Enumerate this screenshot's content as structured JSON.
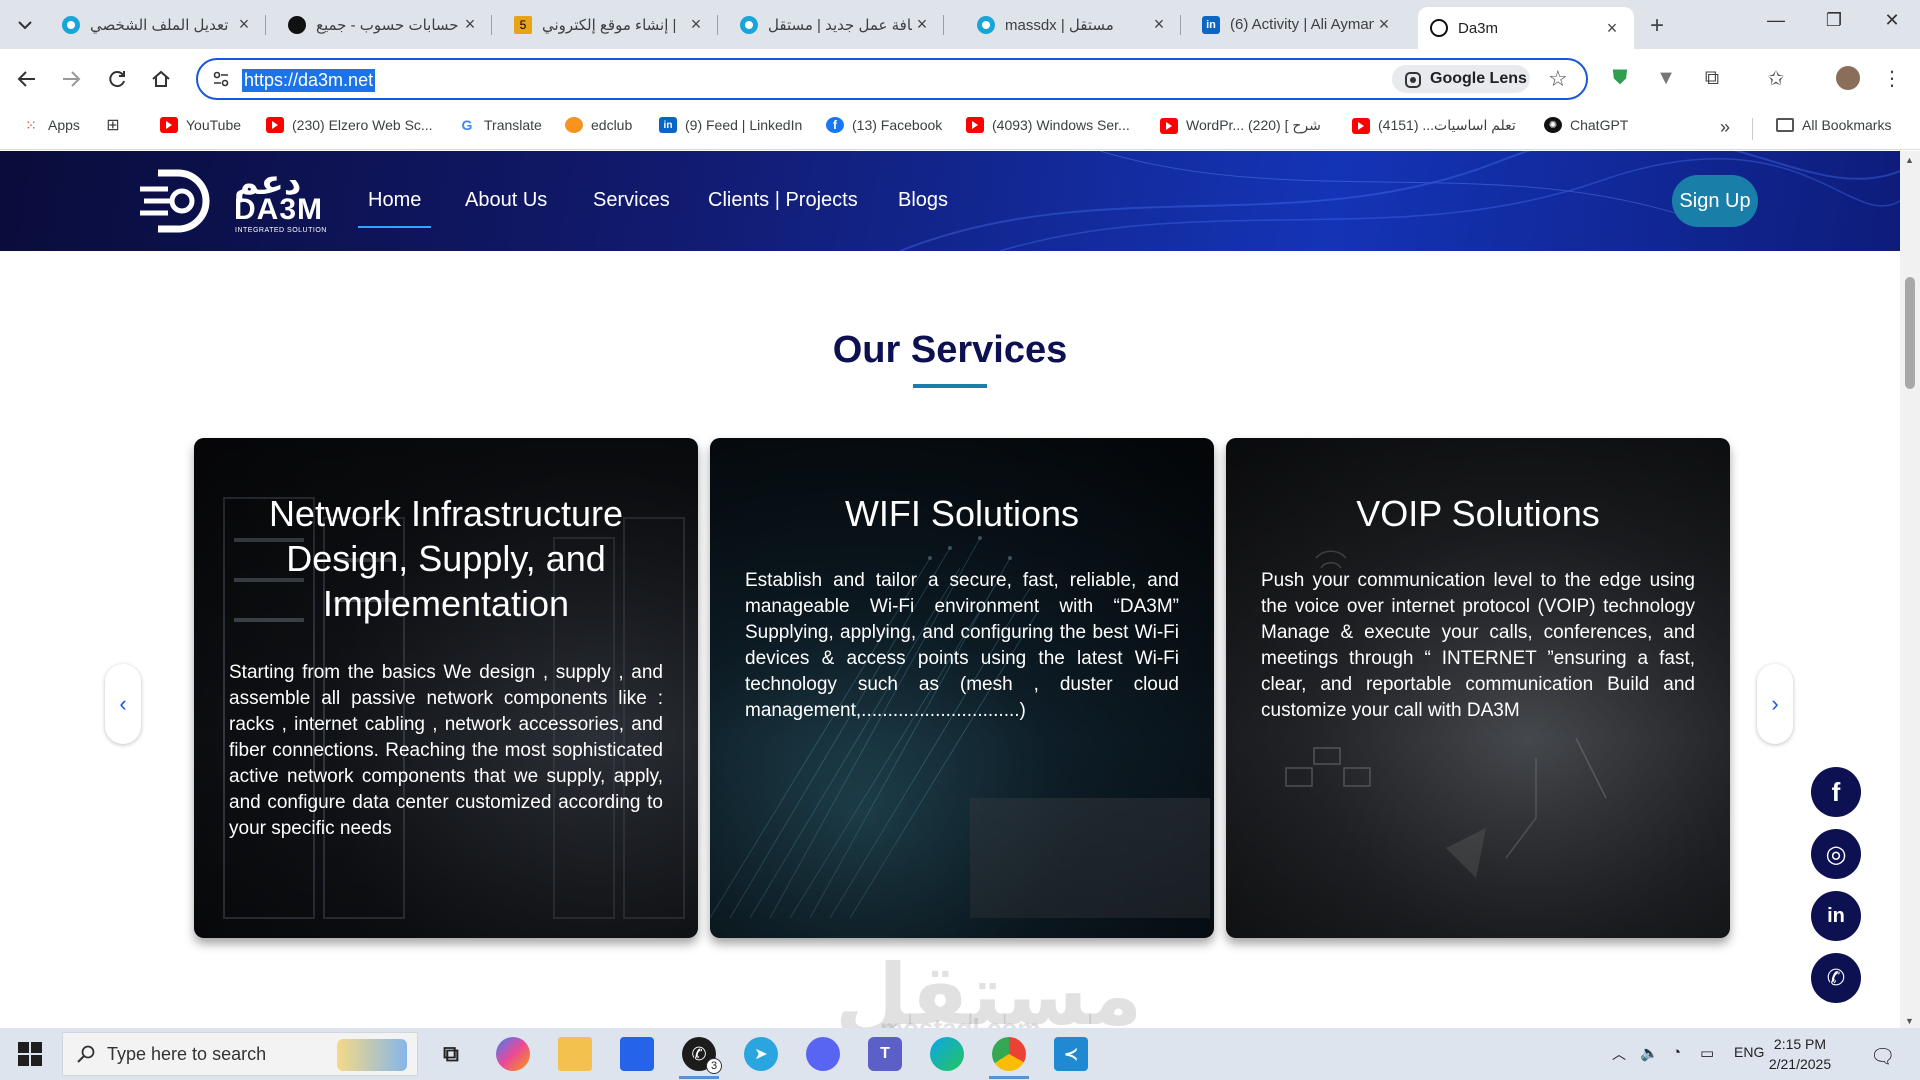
{
  "browser": {
    "tabs": [
      {
        "title": "تعديل الملف الشخصي",
        "icon": "mostaql-icon",
        "active": false
      },
      {
        "title": "حسابات حسوب - جميع",
        "icon": "hsoub-icon",
        "active": false
      },
      {
        "title": "إنشاء موقع إلكتروني |",
        "icon": "five-icon",
        "active": false
      },
      {
        "title": "إضافة عمل جديد | مستقل",
        "icon": "mostaql-icon",
        "active": false
      },
      {
        "title": "massdx | مستقل",
        "icon": "mostaql-icon",
        "active": false
      },
      {
        "title": "(6) Activity | Ali Ayman",
        "icon": "linkedin-icon",
        "active": false
      },
      {
        "title": "Da3m",
        "icon": "da3m-icon",
        "active": true
      }
    ],
    "url": "https://da3m.net",
    "lens_label": "Google Lens",
    "bookmarks": [
      {
        "label": "Apps",
        "icon": "apps-grid-icon"
      },
      {
        "label": "",
        "icon": "grid-icon"
      },
      {
        "label": "YouTube",
        "icon": "youtube-icon"
      },
      {
        "label": "(230) Elzero Web Sc...",
        "icon": "youtube-icon"
      },
      {
        "label": "Translate",
        "icon": "translate-icon"
      },
      {
        "label": "edclub",
        "icon": "edclub-icon"
      },
      {
        "label": "(9) Feed | LinkedIn",
        "icon": "linkedin-icon"
      },
      {
        "label": "(13) Facebook",
        "icon": "facebook-icon"
      },
      {
        "label": "(4093) Windows Ser...",
        "icon": "youtube-icon"
      },
      {
        "label": "WordPr... شرح ] (220)",
        "icon": "youtube-icon"
      },
      {
        "label": "تعلم اساسيات... (4151)",
        "icon": "youtube-icon"
      },
      {
        "label": "ChatGPT",
        "icon": "chatgpt-icon"
      }
    ],
    "all_bookmarks_label": "All Bookmarks"
  },
  "site": {
    "logo": {
      "arabic": "دعم",
      "english": "DA3M",
      "tagline": "INTEGRATED SOLUTION"
    },
    "nav": [
      {
        "label": "Home",
        "active": true
      },
      {
        "label": "About Us",
        "active": false
      },
      {
        "label": "Services",
        "active": false
      },
      {
        "label": "Clients | Projects",
        "active": false
      },
      {
        "label": "Blogs",
        "active": false
      }
    ],
    "signup_label": "Sign Up",
    "section_title": "Our Services",
    "cards": [
      {
        "title": "Network Infrastructure Design, Supply, and Implementation",
        "text": "Starting from the basics We design , supply , and assemble all passive network components like : racks , internet cabling , network accessories, and fiber connections. Reaching the most sophisticated active network components that we supply, apply, and configure data center customized according to your specific needs"
      },
      {
        "title": "WIFI Solutions",
        "text": "Establish and tailor a secure, fast, reliable, and manageable Wi-Fi environment with “DA3M” Supplying, applying, and configuring the best Wi-Fi devices & access points using the latest Wi-Fi technology such as (mesh , duster cloud management,..............................)"
      },
      {
        "title": "VOIP Solutions",
        "text": "Push your communication level to the edge using the voice over internet protocol (VOIP) technology Manage & execute your calls, conferences, and meetings through “ INTERNET ”ensuring a fast, clear, and reportable communication Build and customize your call with DA3M"
      }
    ],
    "carousel": {
      "prev_glyph": "‹",
      "next_glyph": "›"
    },
    "social": [
      {
        "name": "facebook",
        "glyph": "f"
      },
      {
        "name": "instagram",
        "glyph": "◎"
      },
      {
        "name": "linkedin",
        "glyph": "in"
      },
      {
        "name": "whatsapp",
        "glyph": "✆"
      }
    ],
    "watermark": {
      "arabic": "مستقل",
      "latin": "mostaql.com"
    }
  },
  "taskbar": {
    "search_placeholder": "Type here to search",
    "whatsapp_badge": "3",
    "language": "ENG",
    "time": "2:15 PM",
    "date": "2/21/2025"
  },
  "colors": {
    "navy": "#0d1152",
    "accent_teal": "#1a7fa8",
    "omnibox_border": "#1a56db"
  }
}
